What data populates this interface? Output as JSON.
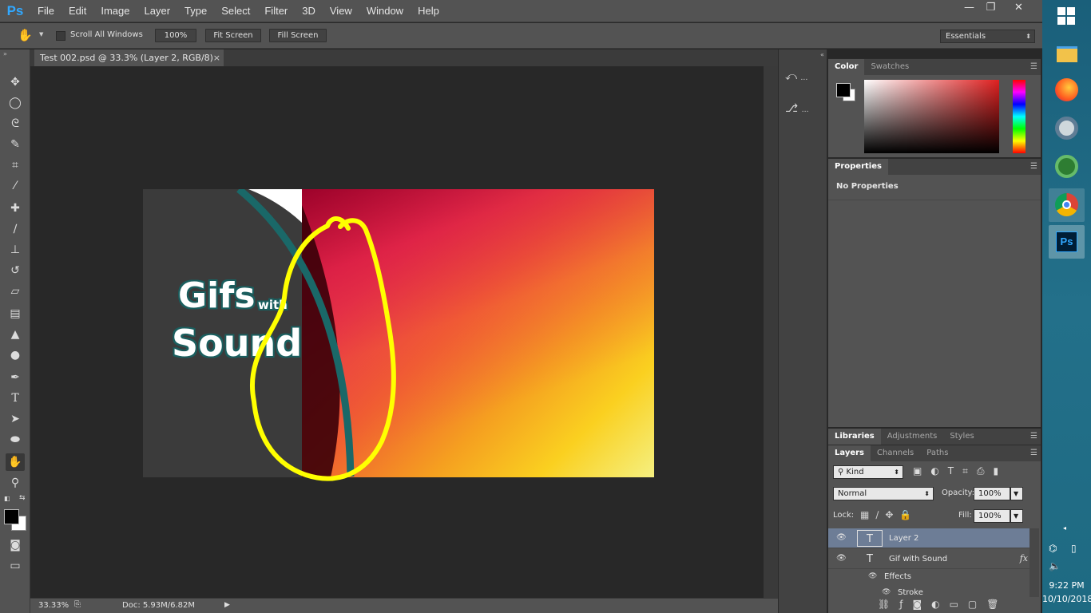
{
  "app": {
    "logo": "Ps"
  },
  "menu": [
    "File",
    "Edit",
    "Image",
    "Layer",
    "Type",
    "Select",
    "Filter",
    "3D",
    "View",
    "Window",
    "Help"
  ],
  "window_controls": {
    "minimize": "—",
    "restore": "❐",
    "close": "✕"
  },
  "options": {
    "scroll_all_windows": "Scroll All Windows",
    "zoom_100": "100%",
    "fit_screen": "Fit Screen",
    "fill_screen": "Fill Screen",
    "workspace": "Essentials"
  },
  "document": {
    "tab_title": "Test 002.psd @ 33.3% (Layer 2, RGB/8)",
    "close": "×",
    "art_text_gifs": "Gifs",
    "art_text_with": "with",
    "art_text_sound": "Sound"
  },
  "status": {
    "zoom": "33.33%",
    "doc_info": "Doc: 5.93M/6.82M"
  },
  "panels": {
    "color_tabs": [
      "Color",
      "Swatches"
    ],
    "properties_tab": "Properties",
    "properties_empty": "No Properties",
    "lib_tabs": [
      "Libraries",
      "Adjustments",
      "Styles"
    ],
    "layers_tabs": [
      "Layers",
      "Channels",
      "Paths"
    ],
    "filter_kind": "Kind",
    "blend_mode": "Normal",
    "opacity_label": "Opacity:",
    "opacity_value": "100%",
    "lock_label": "Lock:",
    "fill_label": "Fill:",
    "fill_value": "100%",
    "fx_label": "fx"
  },
  "layers": [
    {
      "name": "Layer 2",
      "thumb": "T",
      "selected": true
    },
    {
      "name": "Gif with Sound",
      "thumb": "T",
      "selected": false
    },
    {
      "name": "Effects",
      "thumb": "",
      "selected": false
    },
    {
      "name": "Stroke",
      "thumb": "",
      "selected": false
    }
  ],
  "taskbar": {
    "time": "9:22 PM",
    "date": "10/10/2018",
    "ps_label": "Ps"
  },
  "colors": {
    "accent_ps": "#31a8ff",
    "annotation_yellow": "#ffff00",
    "teal_stroke": "#1a5e5e",
    "panel_bg": "#535353",
    "canvas_bg": "#282828"
  }
}
